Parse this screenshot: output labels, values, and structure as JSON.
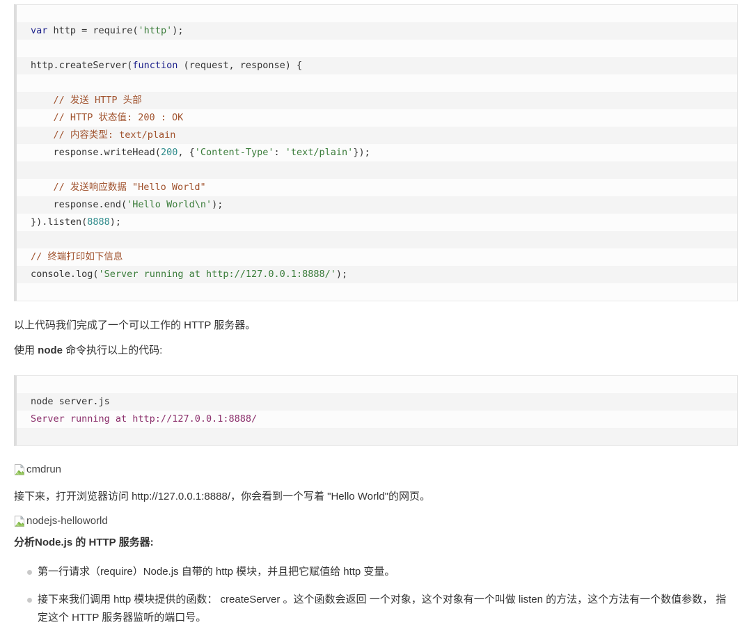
{
  "code_block_main": {
    "name": "server.js",
    "lines": [
      {
        "type": "blank"
      },
      {
        "type": "code",
        "tokens": [
          {
            "t": "var ",
            "c": "kw"
          },
          {
            "t": "http = ",
            "c": "plain"
          },
          {
            "t": "require(",
            "c": "plain"
          },
          {
            "t": "'http'",
            "c": "str"
          },
          {
            "t": ");",
            "c": "plain"
          }
        ]
      },
      {
        "type": "blank"
      },
      {
        "type": "code",
        "tokens": [
          {
            "t": "http.createServer(",
            "c": "plain"
          },
          {
            "t": "function",
            "c": "kw"
          },
          {
            "t": " (request, response) {",
            "c": "plain"
          }
        ]
      },
      {
        "type": "blank"
      },
      {
        "type": "code",
        "tokens": [
          {
            "t": "    // 发送 HTTP 头部",
            "c": "cmt"
          }
        ]
      },
      {
        "type": "code",
        "tokens": [
          {
            "t": "    // HTTP 状态值: 200 : OK",
            "c": "cmt"
          }
        ]
      },
      {
        "type": "code",
        "tokens": [
          {
            "t": "    // 内容类型: text/plain",
            "c": "cmt"
          }
        ]
      },
      {
        "type": "code",
        "tokens": [
          {
            "t": "    response.writeHead(",
            "c": "plain"
          },
          {
            "t": "200",
            "c": "num"
          },
          {
            "t": ", {",
            "c": "plain"
          },
          {
            "t": "'Content-Type'",
            "c": "str"
          },
          {
            "t": ": ",
            "c": "plain"
          },
          {
            "t": "'text/plain'",
            "c": "str"
          },
          {
            "t": "});",
            "c": "plain"
          }
        ]
      },
      {
        "type": "blank"
      },
      {
        "type": "code",
        "tokens": [
          {
            "t": "    // 发送响应数据 \"Hello World\"",
            "c": "cmt"
          }
        ]
      },
      {
        "type": "code",
        "tokens": [
          {
            "t": "    response.end(",
            "c": "plain"
          },
          {
            "t": "'Hello World\\n'",
            "c": "str"
          },
          {
            "t": ");",
            "c": "plain"
          }
        ]
      },
      {
        "type": "code",
        "tokens": [
          {
            "t": "}).listen(",
            "c": "plain"
          },
          {
            "t": "8888",
            "c": "num"
          },
          {
            "t": ");",
            "c": "plain"
          }
        ]
      },
      {
        "type": "blank"
      },
      {
        "type": "code",
        "tokens": [
          {
            "t": "// 终端打印如下信息",
            "c": "cmt"
          }
        ]
      },
      {
        "type": "code",
        "tokens": [
          {
            "t": "console.log(",
            "c": "plain"
          },
          {
            "t": "'Server running at http://127.0.0.1:8888/'",
            "c": "str"
          },
          {
            "t": ");",
            "c": "plain"
          }
        ]
      },
      {
        "type": "blank"
      }
    ]
  },
  "paragraph_result": "以上代码我们完成了一个可以工作的 HTTP 服务器。",
  "paragraph_run_prefix": "使用 ",
  "paragraph_run_bold": "node",
  "paragraph_run_suffix": " 命令执行以上的代码:",
  "code_block_terminal": {
    "lines": [
      {
        "type": "blank"
      },
      {
        "type": "code",
        "tokens": [
          {
            "t": "node server.js",
            "c": "plain"
          }
        ]
      },
      {
        "type": "code",
        "tokens": [
          {
            "t": "Server running at http://127.0.0.1:8888/",
            "c": "term-out"
          }
        ]
      },
      {
        "type": "blank"
      }
    ]
  },
  "image_cmdrun": {
    "alt": "cmdrun",
    "icon": "broken-image-icon"
  },
  "paragraph_browser": "接下来，打开浏览器访问 http://127.0.0.1:8888/，你会看到一个写着 \"Hello World\"的网页。",
  "image_helloworld": {
    "alt": "nodejs-helloworld",
    "icon": "broken-image-icon"
  },
  "heading_analysis": "分析Node.js 的 HTTP 服务器:",
  "bullets": [
    "第一行请求（require）Node.js 自带的 http 模块，并且把它赋值给 http 变量。",
    "接下来我们调用 http 模块提供的函数： createServer 。这个函数会返回 一个对象，这个对象有一个叫做 listen 的方法，这个方法有一个数值参数， 指定这个 HTTP 服务器监听的端口号。"
  ],
  "colors": {
    "keyword": "#1b1f8a",
    "string": "#3a7c3a",
    "comment": "#a0522d",
    "number": "#2e8b8b",
    "terminal_output": "#8b2f6b",
    "code_bg_even": "#fcfcfc",
    "code_bg_odd": "#f4f4f4",
    "code_border_left": "#dddddd",
    "bullet": "#c9c9c9",
    "text": "#333333"
  }
}
